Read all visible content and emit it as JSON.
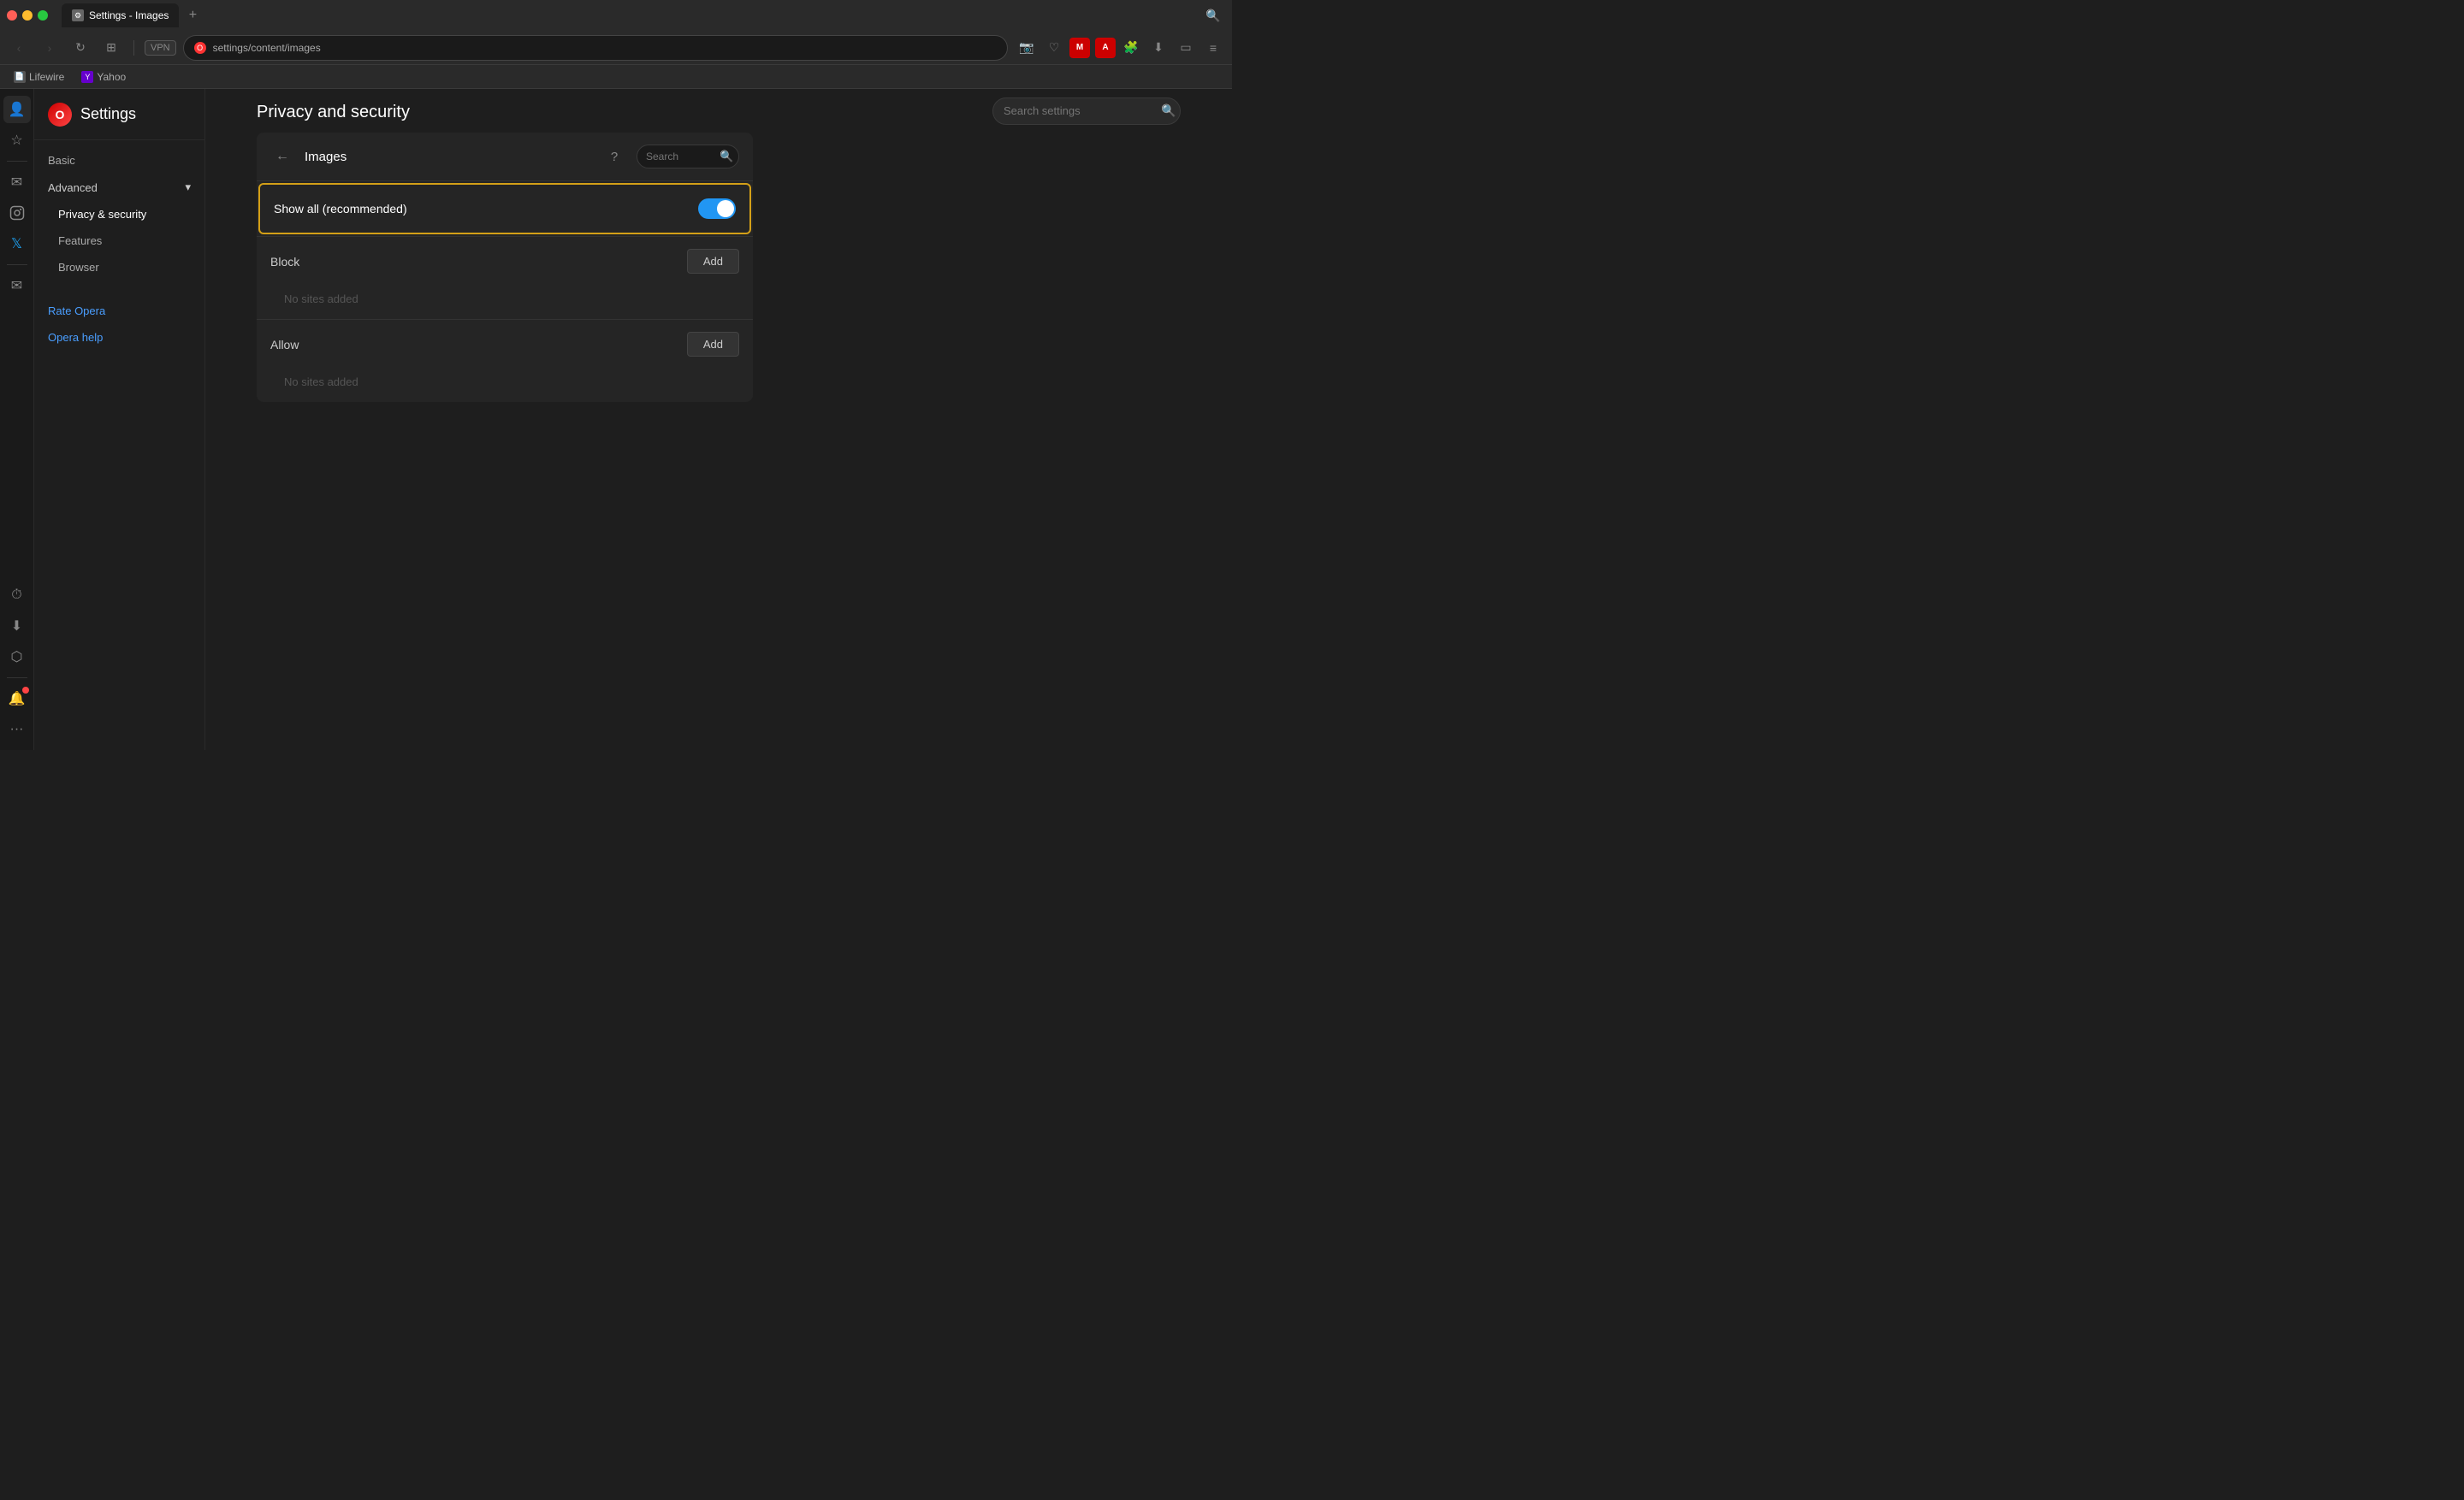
{
  "titlebar": {
    "tab_label": "Settings - Images",
    "new_tab_icon": "+",
    "search_icon": "🔍"
  },
  "navbar": {
    "back_icon": "‹",
    "forward_icon": "›",
    "refresh_icon": "↻",
    "grid_icon": "⊞",
    "vpn_label": "VPN",
    "address": "settings/content/images",
    "camera_icon": "📷",
    "heart_icon": "♡",
    "menu_icon": "≡",
    "extension_icon": "🧩",
    "download_icon": "⬇",
    "window_icon": "▭"
  },
  "bookmarks": [
    {
      "label": "Lifewire",
      "icon": "📄"
    },
    {
      "label": "Yahoo",
      "icon": "Y"
    }
  ],
  "sidebar_icons": [
    {
      "id": "profile",
      "icon": "👤",
      "active": true
    },
    {
      "id": "star",
      "icon": "☆"
    },
    {
      "id": "messenger",
      "icon": "✉"
    },
    {
      "id": "instagram",
      "icon": "◎"
    },
    {
      "id": "twitter",
      "icon": "𝕏"
    },
    {
      "id": "mail",
      "icon": "✉"
    },
    {
      "id": "history",
      "icon": "⏱"
    },
    {
      "id": "downloads",
      "icon": "⬇"
    },
    {
      "id": "extensions",
      "icon": "⬡"
    },
    {
      "id": "notifications",
      "icon": "🔔",
      "badge": true
    },
    {
      "id": "more",
      "icon": "···"
    }
  ],
  "settings": {
    "logo_text": "O",
    "title": "Settings",
    "search_placeholder": "Search settings",
    "search_icon": "🔍"
  },
  "nav": {
    "basic_label": "Basic",
    "advanced_label": "Advanced",
    "advanced_expanded": true,
    "sub_items": [
      {
        "id": "privacy",
        "label": "Privacy & security",
        "active": true
      },
      {
        "id": "features",
        "label": "Features"
      },
      {
        "id": "browser",
        "label": "Browser"
      }
    ],
    "links": [
      {
        "id": "rate",
        "label": "Rate Opera"
      },
      {
        "id": "help",
        "label": "Opera help"
      }
    ]
  },
  "content": {
    "page_title": "Privacy and security",
    "panel": {
      "back_icon": "←",
      "title": "Images",
      "help_icon": "?",
      "search_placeholder": "Search",
      "search_icon": "🔍",
      "toggle_label": "Show all (recommended)",
      "toggle_on": true,
      "block_label": "Block",
      "block_add_label": "Add",
      "block_empty": "No sites added",
      "allow_label": "Allow",
      "allow_add_label": "Add",
      "allow_empty": "No sites added"
    }
  }
}
